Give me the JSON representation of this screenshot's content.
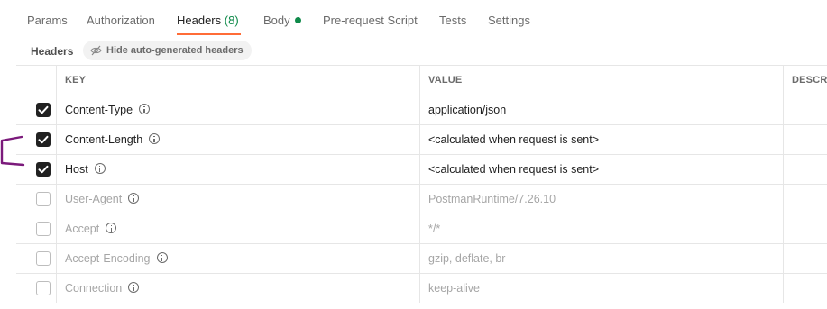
{
  "tabs": [
    {
      "label": "Params"
    },
    {
      "label": "Authorization"
    },
    {
      "label": "Headers",
      "count": "(8)",
      "active": true
    },
    {
      "label": "Body",
      "has_dot": true
    },
    {
      "label": "Pre-request Script"
    },
    {
      "label": "Tests"
    },
    {
      "label": "Settings"
    }
  ],
  "subbar": {
    "label": "Headers",
    "hide_button": "Hide auto-generated headers"
  },
  "table": {
    "columns": [
      "KEY",
      "VALUE",
      "DESCR"
    ],
    "rows": [
      {
        "checked": true,
        "key": "Content-Type",
        "value": "application/json"
      },
      {
        "checked": true,
        "key": "Content-Length",
        "value": "<calculated when request is sent>"
      },
      {
        "checked": true,
        "key": "Host",
        "value": "<calculated when request is sent>"
      },
      {
        "checked": false,
        "key": "User-Agent",
        "value": "PostmanRuntime/7.26.10"
      },
      {
        "checked": false,
        "key": "Accept",
        "value": "*/*"
      },
      {
        "checked": false,
        "key": "Accept-Encoding",
        "value": "gzip, deflate, br"
      },
      {
        "checked": false,
        "key": "Connection",
        "value": "keep-alive"
      }
    ]
  },
  "colors": {
    "accent": "#ff6c37",
    "success": "#0f8a4a",
    "annotation": "#7b1a7b"
  }
}
